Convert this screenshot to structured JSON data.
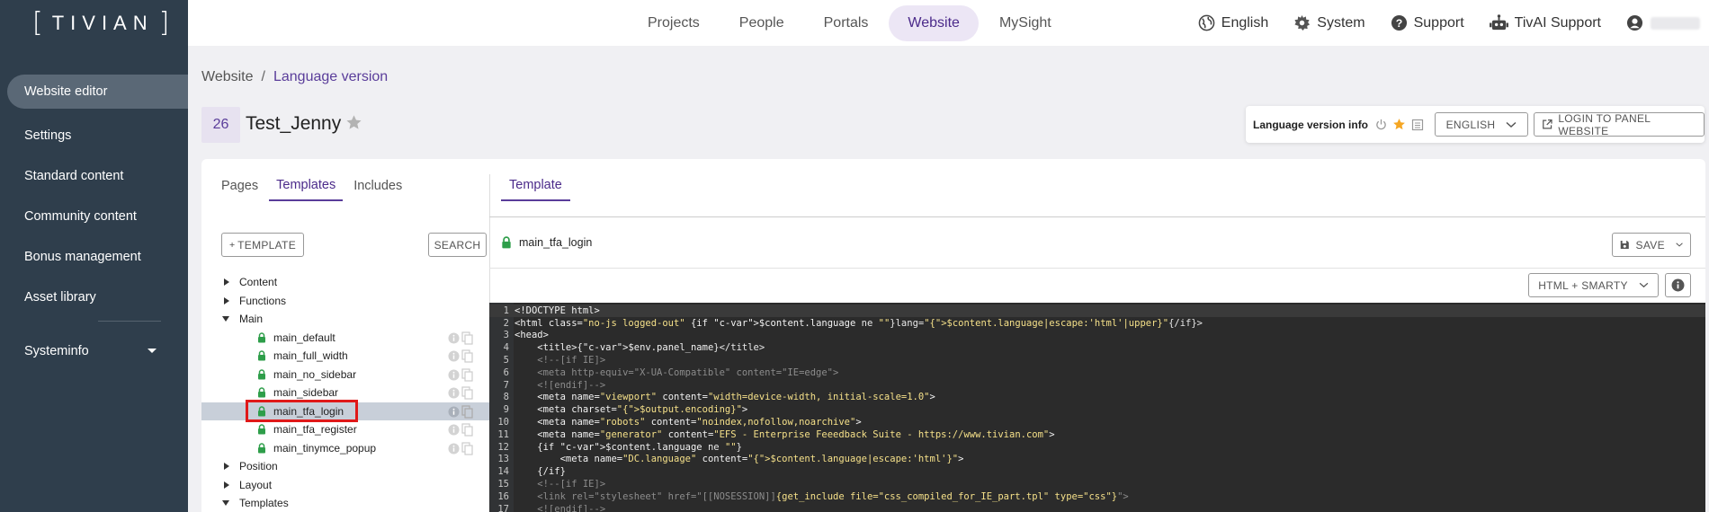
{
  "brand": {
    "name": "TIVIAN"
  },
  "sidebar": {
    "items": [
      {
        "label": "Website editor",
        "active": true
      },
      {
        "label": "Settings"
      },
      {
        "label": "Standard content"
      },
      {
        "label": "Community content"
      },
      {
        "label": "Bonus management"
      },
      {
        "label": "Asset library"
      }
    ],
    "systeminfo": "Systeminfo"
  },
  "topnav": {
    "items": [
      "Projects",
      "People",
      "Portals",
      "Website",
      "MySight"
    ],
    "active": "Website"
  },
  "topright": {
    "language": "English",
    "system": "System",
    "support": "Support",
    "tivai": "TivAI Support"
  },
  "breadcrumb": {
    "root": "Website",
    "separator": "/",
    "current": "Language version"
  },
  "page": {
    "id": "26",
    "title": "Test_Jenny"
  },
  "language_info": {
    "label": "Language version info",
    "language_button": "ENGLISH",
    "login_button": "LOGIN TO PANEL WEBSITE"
  },
  "left_tabs": {
    "pages": "Pages",
    "templates": "Templates",
    "includes": "Includes"
  },
  "buttons": {
    "add_template": "TEMPLATE",
    "search": "SEARCH",
    "save": "SAVE",
    "mode": "HTML + SMARTY"
  },
  "tree": {
    "folders_top": [
      "Content",
      "Functions"
    ],
    "open_folder": "Main",
    "children": [
      "main_default",
      "main_full_width",
      "main_no_sidebar",
      "main_sidebar",
      "main_tfa_login",
      "main_tfa_register",
      "main_tinymce_popup"
    ],
    "selected": "main_tfa_login",
    "folders_bottom": [
      "Position",
      "Layout"
    ],
    "last_folder": "Templates"
  },
  "right_tab": "Template",
  "file_name": "main_tfa_login",
  "colors": {
    "sidebar": "#2f3e4c",
    "accent": "#5a3d9a",
    "highlight": "#e01919",
    "editor_bg": "#2b2b2b"
  },
  "code_lines": [
    "<!DOCTYPE html>",
    "<html class=\"no-js logged-out\" {if $content.language ne \"\"}lang=\"{$content.language|escape:'html'|upper}\"{/if}>",
    "<head>",
    "    <title>{$env.panel_name}</title>",
    "    <!--[if IE]>",
    "    <meta http-equiv=\"X-UA-Compatible\" content=\"IE=edge\">",
    "    <![endif]-->",
    "    <meta name=\"viewport\" content=\"width=device-width, initial-scale=1.0\">",
    "    <meta charset=\"{$output.encoding}\">",
    "    <meta name=\"robots\" content=\"noindex,nofollow,noarchive\">",
    "    <meta name=\"generator\" content=\"EFS - Enterprise Feeedback Suite - https://www.tivian.com\">",
    "    {if $content.language ne \"\"}",
    "        <meta name=\"DC.language\" content=\"{$content.language|escape:'html'}\">",
    "    {/if}",
    "    <!--[if IE]>",
    "    <link rel=\"stylesheet\" href=\"[[NOSESSION]]{get_include file=\"css_compiled_for_IE_part.tpl\" type=\"css\"}\">",
    "    <![endif]-->"
  ]
}
